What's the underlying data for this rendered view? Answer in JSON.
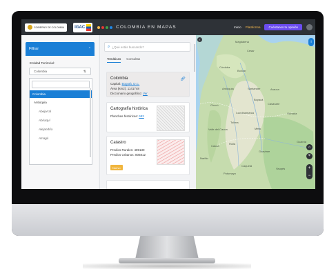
{
  "header": {
    "gov_label": "GOBIERNO DE COLOMBIA",
    "igac_label": "IGAC",
    "app_title": "COLOMBIA EN MAPAS",
    "nav": [
      {
        "label": "Inicio",
        "active": false
      },
      {
        "label": "Plataforma",
        "active": true
      }
    ],
    "help_label": "Cuéntanos tu opinión",
    "brand_dots": [
      "#f6b94d",
      "#e53935",
      "#43a047",
      "#1e88e5"
    ]
  },
  "filter_panel": {
    "title": "Filtrar",
    "entity_label": "Entidad Territorial:",
    "selected_value": "Colombia",
    "options": [
      "Colombia",
      "Antioquia",
      "Abejorral",
      "Abriaquí",
      "Alejandría",
      "Amagá"
    ]
  },
  "content": {
    "search_placeholder": "¿Qué estás buscando?",
    "tabs": [
      "Temáticas",
      "Consultas"
    ],
    "colombia_card": {
      "title": "Colombia",
      "capital_label": "Capital:",
      "capital_value": "Bogotá, D.C.",
      "area": "Área (km2): 1141748",
      "dictionary_label": "Diccionario geográfico:",
      "dictionary_link": "Ver"
    },
    "cartografia_card": {
      "title": "Cartografía histórica",
      "planchas_label": "Planchas históricas:",
      "planchas_value": "683"
    },
    "catastro_card": {
      "title": "Catastro",
      "rural": "Predios Rurales: 489130",
      "urban": "Predios Urbanos: 806812",
      "badge": "Nuevo"
    }
  },
  "map": {
    "labels": [
      "Magdalena",
      "Cesar",
      "Córdoba",
      "Bolívar",
      "Antioquia",
      "Santander",
      "Arauca",
      "Boyacá",
      "Casanare",
      "Chocó",
      "Cundinamarca",
      "Vichada",
      "Tolima",
      "Meta",
      "Valle del Cauca",
      "Cauca",
      "Huila",
      "Guaviare",
      "Nariño",
      "Caquetá",
      "Vaupés",
      "Putumayo",
      "Guainía"
    ],
    "zoom_in": "+",
    "zoom_out": "−"
  }
}
